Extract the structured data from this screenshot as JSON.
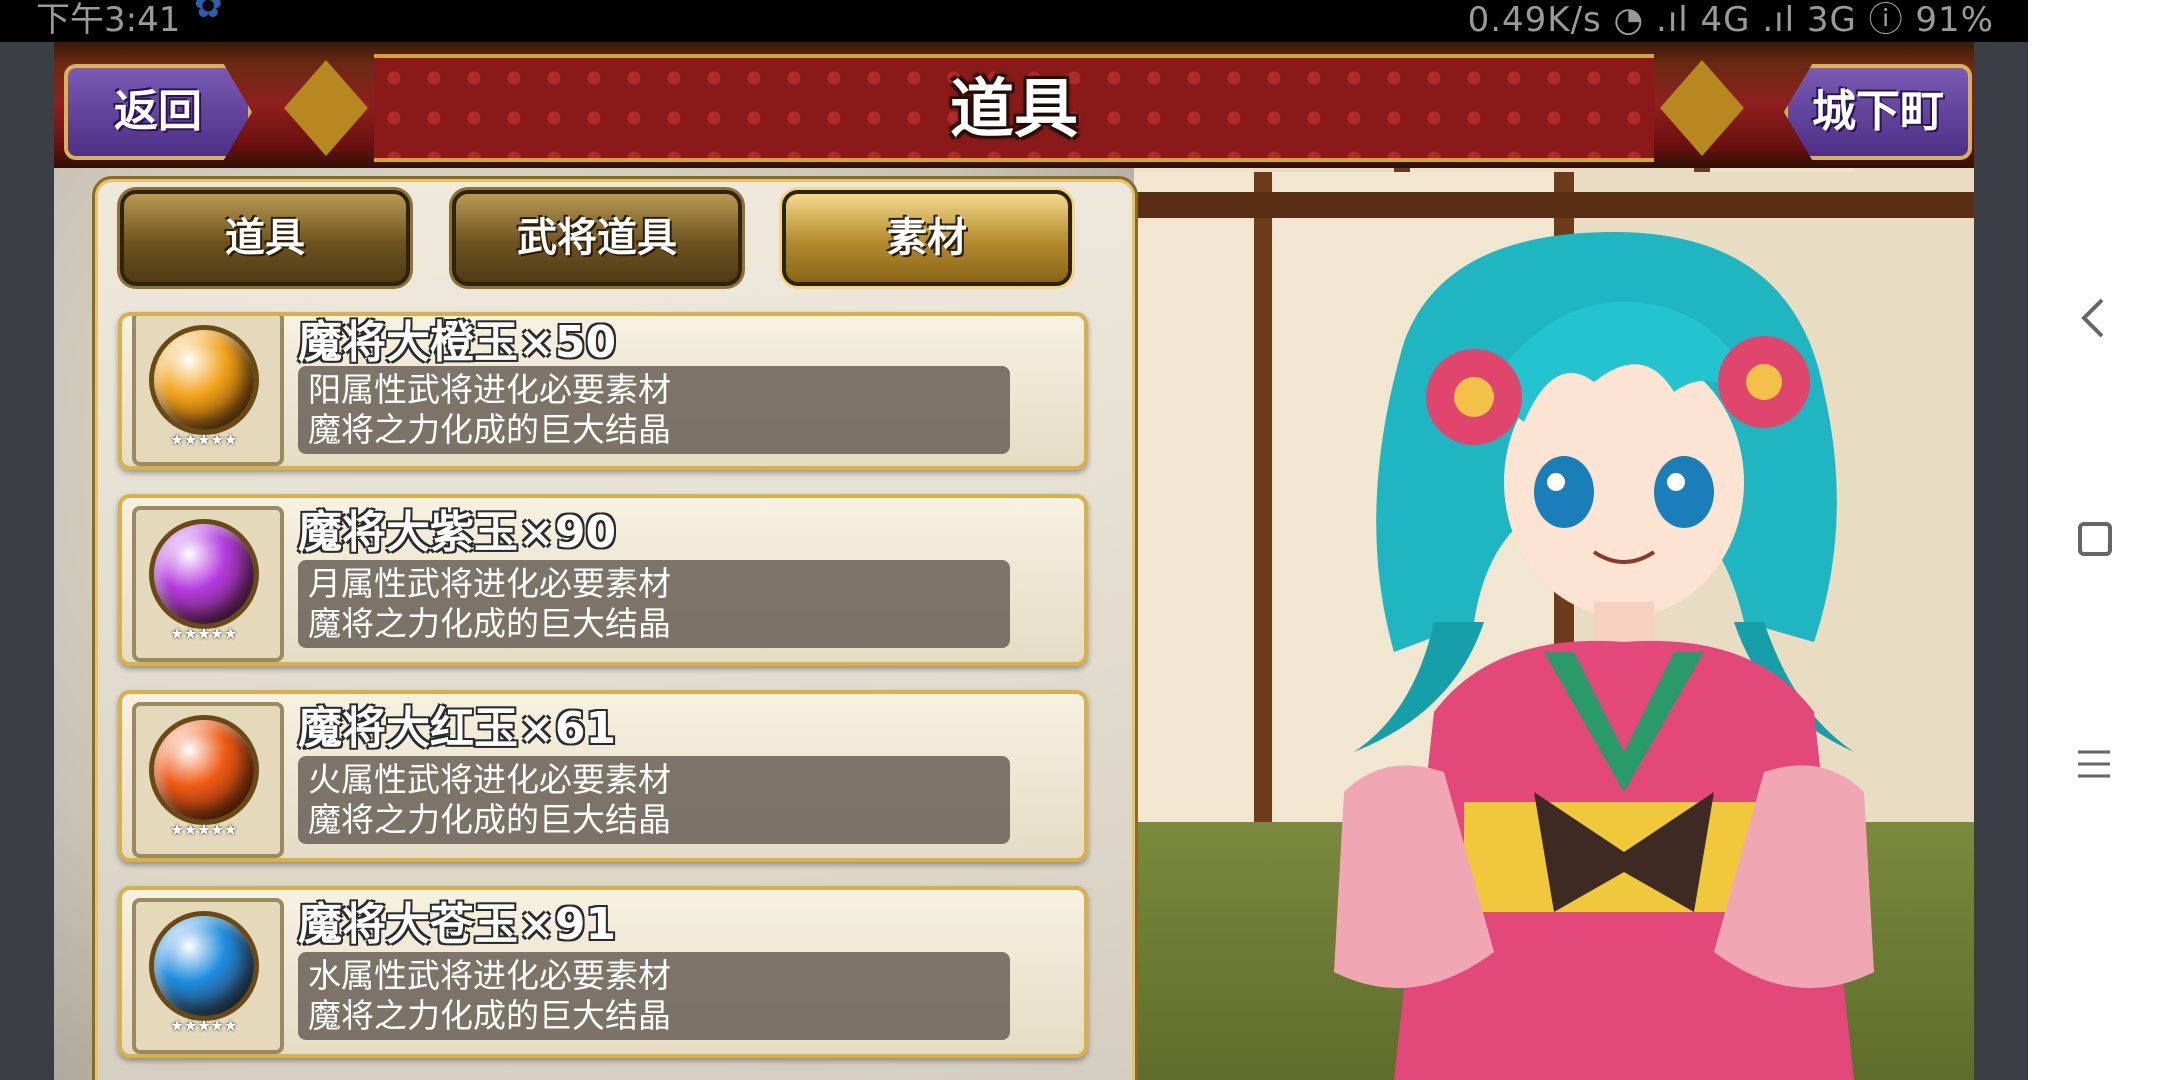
{
  "status_bar": {
    "time": "下午3:41",
    "indicators": "0.49K/s ◔ .ıl 4G .ıl 3G ⓘ 91%"
  },
  "header": {
    "title": "道具",
    "back_label": "返回",
    "town_label": "城下町"
  },
  "tabs": [
    {
      "label": "道具",
      "active": false
    },
    {
      "label": "武将道具",
      "active": false
    },
    {
      "label": "素材",
      "active": true
    }
  ],
  "items": [
    {
      "name": "魔将大橙玉×50",
      "desc1": "阳属性武将进化必要素材",
      "desc2": "魔将之力化成的巨大结晶",
      "orb_color": "#f2a21a",
      "stars": "★★★★★"
    },
    {
      "name": "魔将大紫玉×90",
      "desc1": "月属性武将进化必要素材",
      "desc2": "魔将之力化成的巨大结晶",
      "orb_color": "#b43be0",
      "stars": "★★★★★"
    },
    {
      "name": "魔将大红玉×61",
      "desc1": "火属性武将进化必要素材",
      "desc2": "魔将之力化成的巨大结晶",
      "orb_color": "#ef5a14",
      "stars": "★★★★★"
    },
    {
      "name": "魔将大苍玉×91",
      "desc1": "水属性武将进化必要素材",
      "desc2": "魔将之力化成的巨大结晶",
      "orb_color": "#1e8be0",
      "stars": "★★★★★"
    }
  ],
  "icons": {
    "nav_back": "chevron-left-icon",
    "nav_home": "square-icon",
    "nav_menu": "menu-icon"
  },
  "colors": {
    "header_red": "#8f1f1d",
    "tab_active": "#f3da8c",
    "button_purple": "#5a3a95"
  }
}
